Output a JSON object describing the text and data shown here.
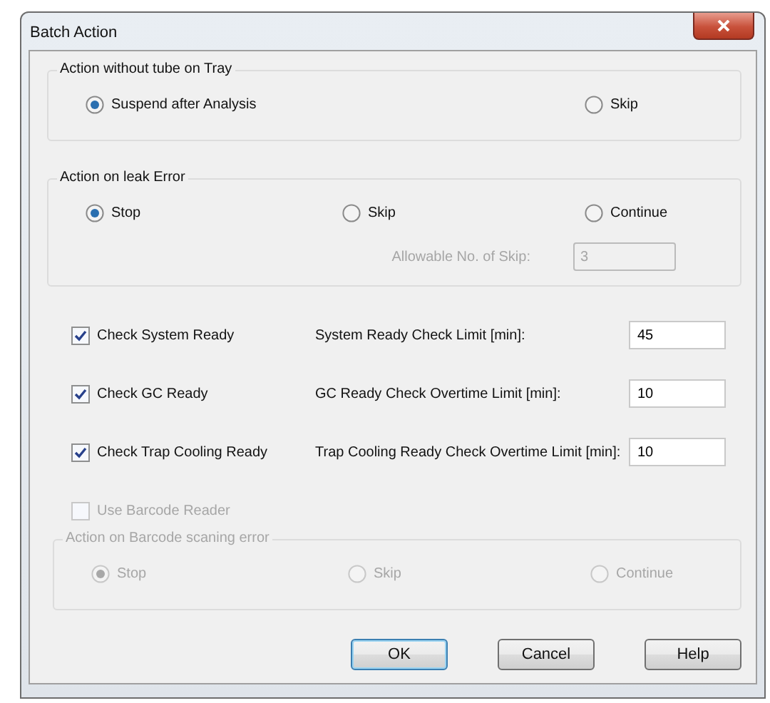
{
  "window": {
    "title": "Batch Action"
  },
  "tube_action": {
    "title": "Action without tube on Tray",
    "disabled": false,
    "options": [
      {
        "label": "Suspend after Analysis",
        "selected": true
      },
      {
        "label": "Skip",
        "selected": false
      }
    ]
  },
  "leak_action": {
    "title": "Action on leak Error",
    "disabled": false,
    "options": [
      {
        "label": "Stop",
        "selected": true
      },
      {
        "label": "Skip",
        "selected": false
      },
      {
        "label": "Continue",
        "selected": false
      }
    ],
    "skip_limit": {
      "label": "Allowable No. of Skip:",
      "value": "3",
      "disabled": true
    }
  },
  "checks": [
    {
      "label": "Check System Ready",
      "checked": true,
      "limit_label": "System Ready Check Limit [min]:",
      "value": "45"
    },
    {
      "label": "Check GC Ready",
      "checked": true,
      "limit_label": "GC Ready Check Overtime Limit [min]:",
      "value": "10"
    },
    {
      "label": "Check Trap Cooling Ready",
      "checked": true,
      "limit_label": "Trap Cooling Ready Check Overtime Limit [min]:",
      "value": "10"
    }
  ],
  "barcode": {
    "label": "Use Barcode Reader",
    "checked": false,
    "disabled": true
  },
  "barcode_action": {
    "title": "Action on Barcode scaning error",
    "disabled": true,
    "options": [
      {
        "label": "Stop",
        "selected": true
      },
      {
        "label": "Skip",
        "selected": false
      },
      {
        "label": "Continue",
        "selected": false
      }
    ]
  },
  "buttons": [
    {
      "label": "OK",
      "default": true
    },
    {
      "label": "Cancel",
      "default": false
    },
    {
      "label": "Help",
      "default": false
    }
  ]
}
